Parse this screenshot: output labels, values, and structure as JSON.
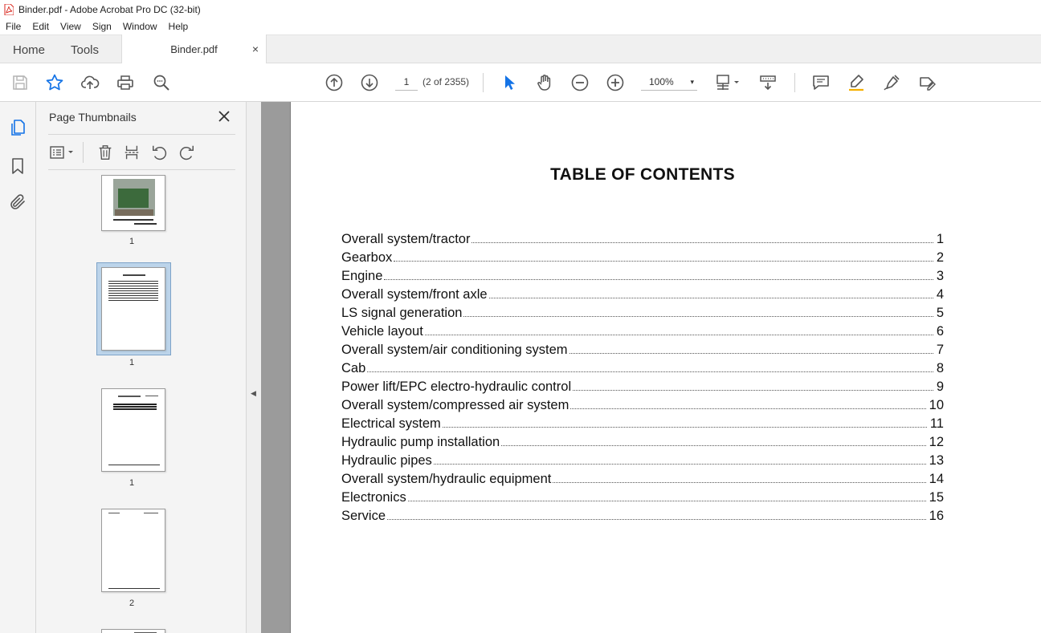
{
  "window": {
    "title": "Binder.pdf - Adobe Acrobat Pro DC (32-bit)"
  },
  "menu": [
    "File",
    "Edit",
    "View",
    "Sign",
    "Window",
    "Help"
  ],
  "tabs": {
    "home": "Home",
    "tools": "Tools",
    "document": "Binder.pdf",
    "close_glyph": "×"
  },
  "toolbar": {
    "page_number": "1",
    "page_count": "(2 of 2355)",
    "zoom": "100%",
    "zoom_caret": "▾"
  },
  "panel": {
    "title": "Page Thumbnails",
    "close_glyph": "✕",
    "thumbnails": [
      {
        "label": "1",
        "selected": false
      },
      {
        "label": "1",
        "selected": true
      },
      {
        "label": "1",
        "selected": false
      },
      {
        "label": "2",
        "selected": false
      }
    ]
  },
  "collapse_glyph": "◀",
  "document": {
    "title": "TABLE OF CONTENTS",
    "entries": [
      {
        "label": "Overall system/tractor",
        "page": "1"
      },
      {
        "label": "Gearbox",
        "page": "2"
      },
      {
        "label": "Engine",
        "page": "3"
      },
      {
        "label": "Overall system/front axle",
        "page": "4"
      },
      {
        "label": "LS signal generation",
        "page": "5"
      },
      {
        "label": "Vehicle layout",
        "page": "6"
      },
      {
        "label": "Overall system/air conditioning system",
        "page": "7"
      },
      {
        "label": "Cab",
        "page": "8"
      },
      {
        "label": "Power lift/EPC electro-hydraulic control",
        "page": "9"
      },
      {
        "label": "Overall system/compressed air system",
        "page": "10"
      },
      {
        "label": "Electrical system",
        "page": "11"
      },
      {
        "label": "Hydraulic pump installation",
        "page": "12"
      },
      {
        "label": "Hydraulic pipes",
        "page": "13"
      },
      {
        "label": "Overall system/hydraulic equipment",
        "page": "14"
      },
      {
        "label": "Electronics",
        "page": "15"
      },
      {
        "label": "Service",
        "page": "16"
      }
    ]
  },
  "colors": {
    "accent": "#1473e6",
    "pdf_red": "#d9261c",
    "gutter": "#9b9b9b"
  }
}
